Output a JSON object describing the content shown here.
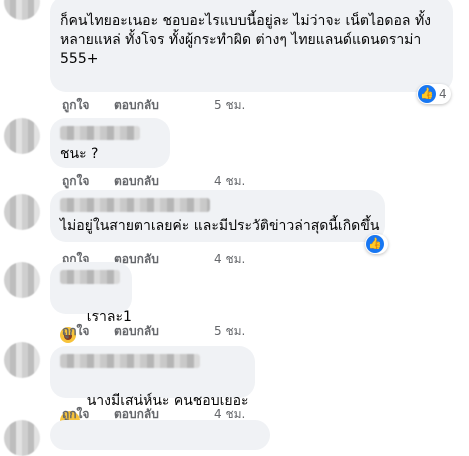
{
  "comments": [
    {
      "text": "ก็คนไทยอะเนอะ ชอบอะไรแบบนี้อยู่ละ ไม่ว่าจะ เน็ตไอดอล ทั้งหลายแหล่ ทั้งโจร ทั้งผู้กระทำผิด ต่างๆ ไทยแลนด์แดนดราม่า 555+",
      "like": "ถูกใจ",
      "reply": "ตอบกลับ",
      "time": "5 ชม.",
      "reaction": {
        "icon": "like-icon",
        "count": "4"
      }
    },
    {
      "text": "ชนะ ?",
      "like": "ถูกใจ",
      "reply": "ตอบกลับ",
      "time": "4 ชม."
    },
    {
      "text": "ไม่อยู่ในสายตาเลยค่ะ และมีประวัติข่าวล่าสุดนี้เกิดขึ้น",
      "like": "ถูกใจ",
      "reply": "ตอบกลับ",
      "time": "4 ชม.",
      "reaction": {
        "icon": "like-icon",
        "count": ""
      }
    },
    {
      "text": "เราละ1",
      "emoji": "rofl-emoji",
      "like": "ถูกใจ",
      "reply": "ตอบกลับ",
      "time": "5 ชม."
    },
    {
      "text": "นางมีเสน่ห์นะ คนชอบเยอะ",
      "emoji": "laughing-emoji",
      "like": "ถูกใจ",
      "reply": "ตอบกลับ",
      "time": "4 ชม."
    }
  ],
  "colors": {
    "bubble": "#f0f2f5",
    "meta": "#65676b",
    "like_blue": "#1877f2",
    "emoji_yellow": "#f7c33b"
  }
}
